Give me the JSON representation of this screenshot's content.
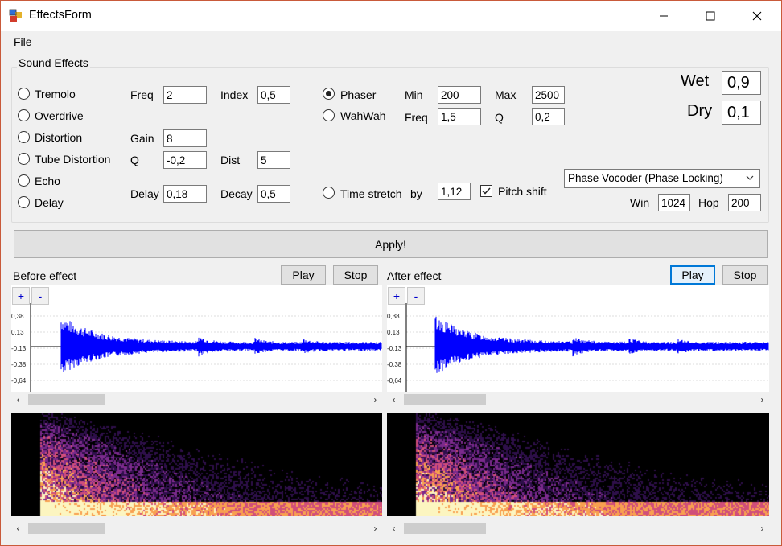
{
  "window": {
    "title": "EffectsForm"
  },
  "menu": {
    "file": "File"
  },
  "group": {
    "title": "Sound Effects"
  },
  "effects": [
    {
      "label": "Tremolo",
      "checked": false
    },
    {
      "label": "Overdrive",
      "checked": false
    },
    {
      "label": "Distortion",
      "checked": false
    },
    {
      "label": "Tube Distortion",
      "checked": false
    },
    {
      "label": "Echo",
      "checked": false
    },
    {
      "label": "Delay",
      "checked": false
    }
  ],
  "tremolo": {
    "freq_label": "Freq",
    "freq": "2",
    "index_label": "Index",
    "index": "0,5"
  },
  "distortion": {
    "gain_label": "Gain",
    "gain": "8"
  },
  "tube": {
    "q_label": "Q",
    "q": "-0,2",
    "dist_label": "Dist",
    "dist": "5"
  },
  "delay": {
    "delay_label": "Delay",
    "delay": "0,18",
    "decay_label": "Decay",
    "decay": "0,5"
  },
  "modulation": {
    "phaser_label": "Phaser",
    "phaser_checked": true,
    "wahwah_label": "WahWah",
    "wahwah_checked": false,
    "min_label": "Min",
    "min": "200",
    "max_label": "Max",
    "max": "2500",
    "freq_label": "Freq",
    "freq": "1,5",
    "q_label": "Q",
    "q": "0,2"
  },
  "mix": {
    "wet_label": "Wet",
    "wet": "0,9",
    "dry_label": "Dry",
    "dry": "0,1"
  },
  "stretch": {
    "label": "Time stretch",
    "by_label": "by",
    "by": "1,12",
    "pitch_shift_label": "Pitch shift",
    "pitch_shift_checked": true,
    "algorithm": "Phase Vocoder (Phase Locking)",
    "win_label": "Win",
    "win": "1024",
    "hop_label": "Hop",
    "hop": "200"
  },
  "apply_label": "Apply!",
  "before": {
    "title": "Before effect",
    "play": "Play",
    "stop": "Stop"
  },
  "after": {
    "title": "After effect",
    "play": "Play",
    "stop": "Stop"
  },
  "zoom": {
    "plus": "+",
    "minus": "-"
  },
  "amplitude_ticks": [
    "0,38",
    "0,13",
    "-0,13",
    "-0,38",
    "-0,64"
  ],
  "colors": {
    "waveform": "#0000ff",
    "focus": "#0078d7"
  }
}
